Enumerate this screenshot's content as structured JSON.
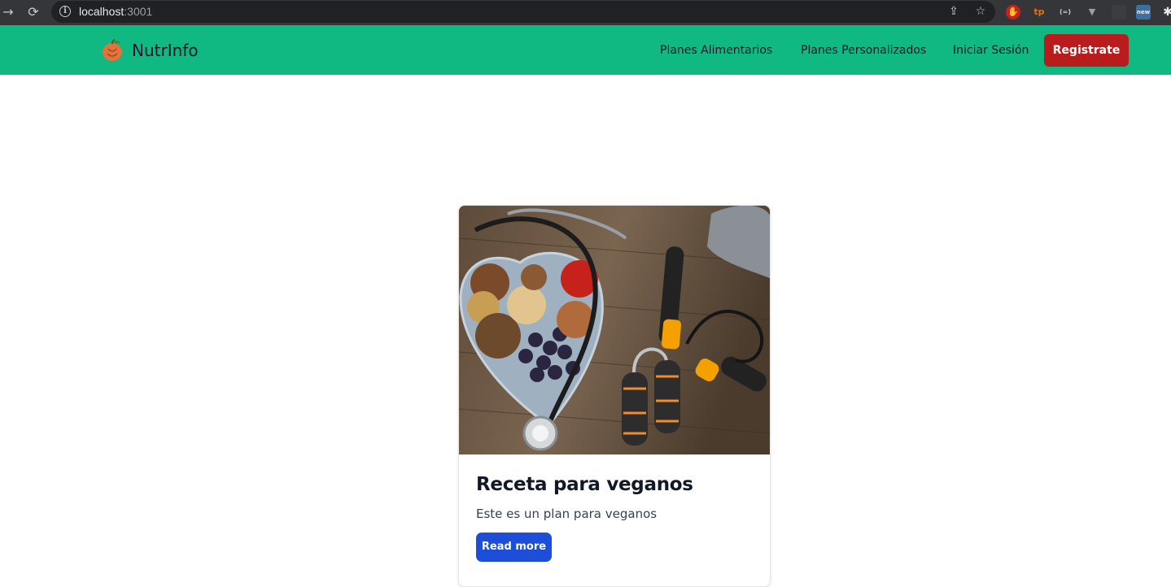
{
  "browser": {
    "url_host": "localhost",
    "url_port": ":3001",
    "back_icon": "arrow-right-icon",
    "reload_icon": "reload-icon",
    "extensions": [
      "tp",
      "(=)",
      "new"
    ]
  },
  "navbar": {
    "brand_name": "NutrInfo",
    "links": [
      "Planes Alimentarios",
      "Planes Personalizados",
      "Iniciar Sesión"
    ],
    "cta_label": "Registrate",
    "bg_color": "#10b981",
    "cta_color": "#b91c1c"
  },
  "card": {
    "title": "Receta para veganos",
    "description": "Este es un plan para veganos",
    "button_label": "Read more",
    "button_color": "#1d4ed8"
  }
}
